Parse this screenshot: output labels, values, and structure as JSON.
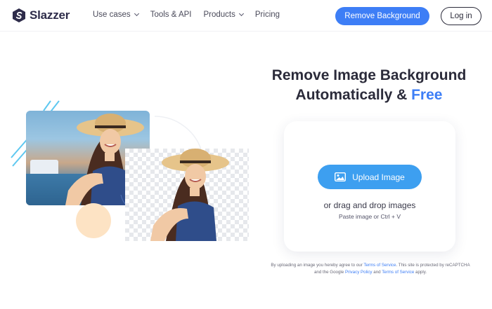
{
  "brand": {
    "name": "Slazzer",
    "accent": "#3d7ef6",
    "upload_color": "#3d9ff0"
  },
  "nav": {
    "items": [
      {
        "label": "Use cases",
        "has_dropdown": true
      },
      {
        "label": "Tools & API",
        "has_dropdown": false
      },
      {
        "label": "Products",
        "has_dropdown": true
      },
      {
        "label": "Pricing",
        "has_dropdown": false
      }
    ],
    "cta_label": "Remove Background",
    "login_label": "Log in"
  },
  "hero": {
    "headline_line1": "Remove Image Background",
    "headline_line2": "Automatically &",
    "headline_highlight": "Free",
    "upload_label": "Upload Image",
    "drag_text": "or drag and drop images",
    "paste_text": "Paste image or Ctrl + V",
    "images": {
      "original_icon": "photo-icon",
      "cutout_icon": "transparent-cutout"
    }
  },
  "legal": {
    "part1": "By uploading an image you hereby agree to our",
    "terms_link": "Terms of Service",
    "part2": ". This site is protected by reCAPTCHA and the Google",
    "privacy_link": "Privacy Policy",
    "part3": "and",
    "terms_link2": "Terms of Service",
    "part4": "apply."
  }
}
